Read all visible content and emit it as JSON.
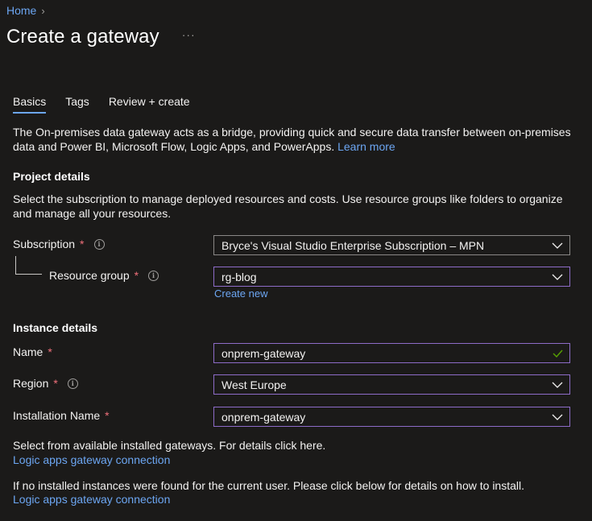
{
  "breadcrumb": {
    "home": "Home",
    "separator": "›"
  },
  "page": {
    "title": "Create a gateway",
    "more": "···"
  },
  "tabs": [
    {
      "label": "Basics",
      "active": true
    },
    {
      "label": "Tags",
      "active": false
    },
    {
      "label": "Review + create",
      "active": false
    }
  ],
  "intro": {
    "text": "The On-premises data gateway acts as a bridge, providing quick and secure data transfer between on-premises data and Power BI, Microsoft Flow, Logic Apps, and PowerApps.",
    "learn_more": "Learn more"
  },
  "project_details": {
    "title": "Project details",
    "description": "Select the subscription to manage deployed resources and costs. Use resource groups like folders to organize and manage all your resources.",
    "subscription_label": "Subscription",
    "subscription_value": "Bryce's Visual Studio Enterprise Subscription – MPN",
    "resource_group_label": "Resource group",
    "resource_group_value": "rg-blog",
    "create_new": "Create new"
  },
  "instance_details": {
    "title": "Instance details",
    "name_label": "Name",
    "name_value": "onprem-gateway",
    "region_label": "Region",
    "region_value": "West Europe",
    "installation_label": "Installation Name",
    "installation_value": "onprem-gateway"
  },
  "footer": {
    "select_text": "Select from available installed gateways. For details click here.",
    "link1": "Logic apps gateway connection",
    "none_text": "If no installed instances were found for the current user. Please click below for details on how to install.",
    "link2": "Logic apps gateway connection"
  },
  "required_mark": "*",
  "info_glyph": "i",
  "colors": {
    "background": "#1b1a19",
    "link": "#6ca6f2",
    "required": "#f1707b",
    "focus_border": "#8e6cc8",
    "valid_check": "#57a300"
  }
}
